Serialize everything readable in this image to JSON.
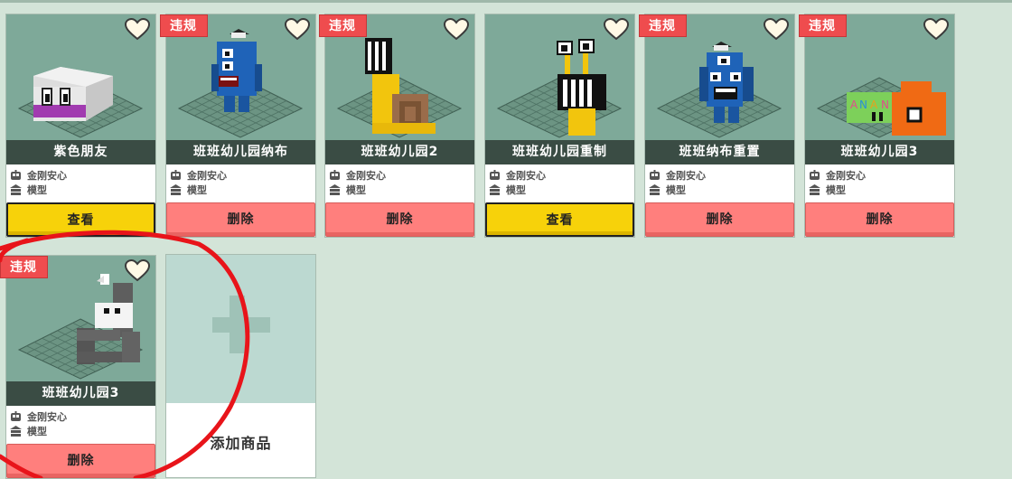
{
  "colors": {
    "violation_badge": "#ef4c4e",
    "view_button": "#f7d20a",
    "delete_button": "#ff7f7d",
    "name_bar": "#3a4c44",
    "thumb_bg": "#7ea999"
  },
  "products": [
    {
      "name": "紫色朋友",
      "author": "金刚安心",
      "category": "模型",
      "badge": "",
      "action": "查看",
      "action_type": "view",
      "figure": "purple-box"
    },
    {
      "name": "班班幼儿园纳布",
      "author": "金刚安心",
      "category": "模型",
      "badge": "违规",
      "action": "删除",
      "action_type": "delete",
      "figure": "blue-monster"
    },
    {
      "name": "班班幼儿园2",
      "author": "金刚安心",
      "category": "模型",
      "badge": "违规",
      "action": "删除",
      "action_type": "delete",
      "figure": "yellow-snail"
    },
    {
      "name": "班班幼儿园重制",
      "author": "金刚安心",
      "category": "模型",
      "badge": "",
      "action": "查看",
      "action_type": "view",
      "figure": "yellow-slug"
    },
    {
      "name": "班班纳布重置",
      "author": "金刚安心",
      "category": "模型",
      "badge": "违规",
      "action": "删除",
      "action_type": "delete",
      "figure": "blue-monster-2"
    },
    {
      "name": "班班幼儿园3",
      "author": "金刚安心",
      "category": "模型",
      "badge": "违规",
      "action": "删除",
      "action_type": "delete",
      "figure": "orange-train"
    },
    {
      "name": "班班幼儿园3",
      "author": "金刚安心",
      "category": "模型",
      "badge": "违规",
      "action": "删除",
      "action_type": "delete",
      "figure": "grey-crane"
    }
  ],
  "add_card": {
    "label": "添加商品",
    "icon": "plus-icon"
  },
  "icons": {
    "author": "robot-icon",
    "category": "model-icon",
    "favorite": "heart-icon"
  }
}
